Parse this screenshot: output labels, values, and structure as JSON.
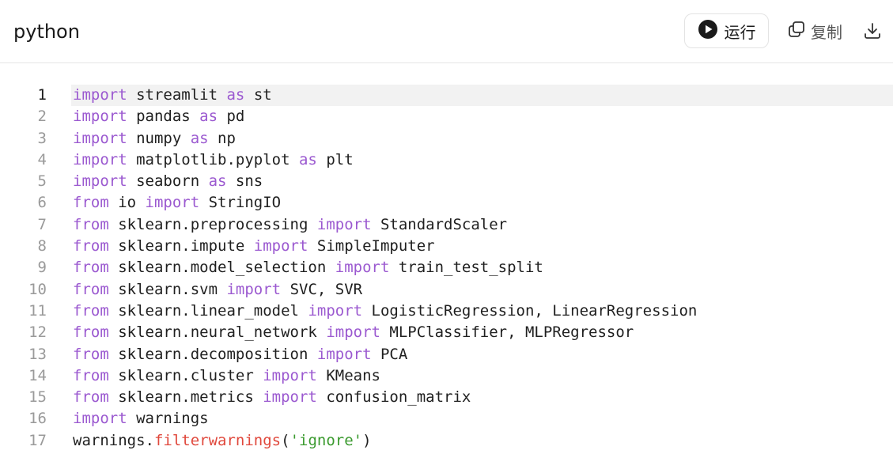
{
  "header": {
    "language": "python",
    "run_label": "运行",
    "copy_label": "复制",
    "icons": {
      "run": "play-circle-icon",
      "copy": "copy-icon",
      "download": "download-icon"
    }
  },
  "code": {
    "active_line": 1,
    "lines": [
      [
        [
          "kw",
          "import"
        ],
        [
          "t",
          " streamlit "
        ],
        [
          "kw",
          "as"
        ],
        [
          "t",
          " st"
        ]
      ],
      [
        [
          "kw",
          "import"
        ],
        [
          "t",
          " pandas "
        ],
        [
          "kw",
          "as"
        ],
        [
          "t",
          " pd"
        ]
      ],
      [
        [
          "kw",
          "import"
        ],
        [
          "t",
          " numpy "
        ],
        [
          "kw",
          "as"
        ],
        [
          "t",
          " np"
        ]
      ],
      [
        [
          "kw",
          "import"
        ],
        [
          "t",
          " matplotlib.pyplot "
        ],
        [
          "kw",
          "as"
        ],
        [
          "t",
          " plt"
        ]
      ],
      [
        [
          "kw",
          "import"
        ],
        [
          "t",
          " seaborn "
        ],
        [
          "kw",
          "as"
        ],
        [
          "t",
          " sns"
        ]
      ],
      [
        [
          "kw",
          "from"
        ],
        [
          "t",
          " io "
        ],
        [
          "kw",
          "import"
        ],
        [
          "t",
          " StringIO"
        ]
      ],
      [
        [
          "kw",
          "from"
        ],
        [
          "t",
          " sklearn.preprocessing "
        ],
        [
          "kw",
          "import"
        ],
        [
          "t",
          " StandardScaler"
        ]
      ],
      [
        [
          "kw",
          "from"
        ],
        [
          "t",
          " sklearn.impute "
        ],
        [
          "kw",
          "import"
        ],
        [
          "t",
          " SimpleImputer"
        ]
      ],
      [
        [
          "kw",
          "from"
        ],
        [
          "t",
          " sklearn.model_selection "
        ],
        [
          "kw",
          "import"
        ],
        [
          "t",
          " train_test_split"
        ]
      ],
      [
        [
          "kw",
          "from"
        ],
        [
          "t",
          " sklearn.svm "
        ],
        [
          "kw",
          "import"
        ],
        [
          "t",
          " SVC, SVR"
        ]
      ],
      [
        [
          "kw",
          "from"
        ],
        [
          "t",
          " sklearn.linear_model "
        ],
        [
          "kw",
          "import"
        ],
        [
          "t",
          " LogisticRegression, LinearRegression"
        ]
      ],
      [
        [
          "kw",
          "from"
        ],
        [
          "t",
          " sklearn.neural_network "
        ],
        [
          "kw",
          "import"
        ],
        [
          "t",
          " MLPClassifier, MLPRegressor"
        ]
      ],
      [
        [
          "kw",
          "from"
        ],
        [
          "t",
          " sklearn.decomposition "
        ],
        [
          "kw",
          "import"
        ],
        [
          "t",
          " PCA"
        ]
      ],
      [
        [
          "kw",
          "from"
        ],
        [
          "t",
          " sklearn.cluster "
        ],
        [
          "kw",
          "import"
        ],
        [
          "t",
          " KMeans"
        ]
      ],
      [
        [
          "kw",
          "from"
        ],
        [
          "t",
          " sklearn.metrics "
        ],
        [
          "kw",
          "import"
        ],
        [
          "t",
          " confusion_matrix"
        ]
      ],
      [
        [
          "kw",
          "import"
        ],
        [
          "t",
          " warnings"
        ]
      ],
      [
        [
          "t",
          "warnings."
        ],
        [
          "fn",
          "filterwarnings"
        ],
        [
          "t",
          "("
        ],
        [
          "str",
          "'ignore'"
        ],
        [
          "t",
          ")"
        ]
      ]
    ]
  }
}
